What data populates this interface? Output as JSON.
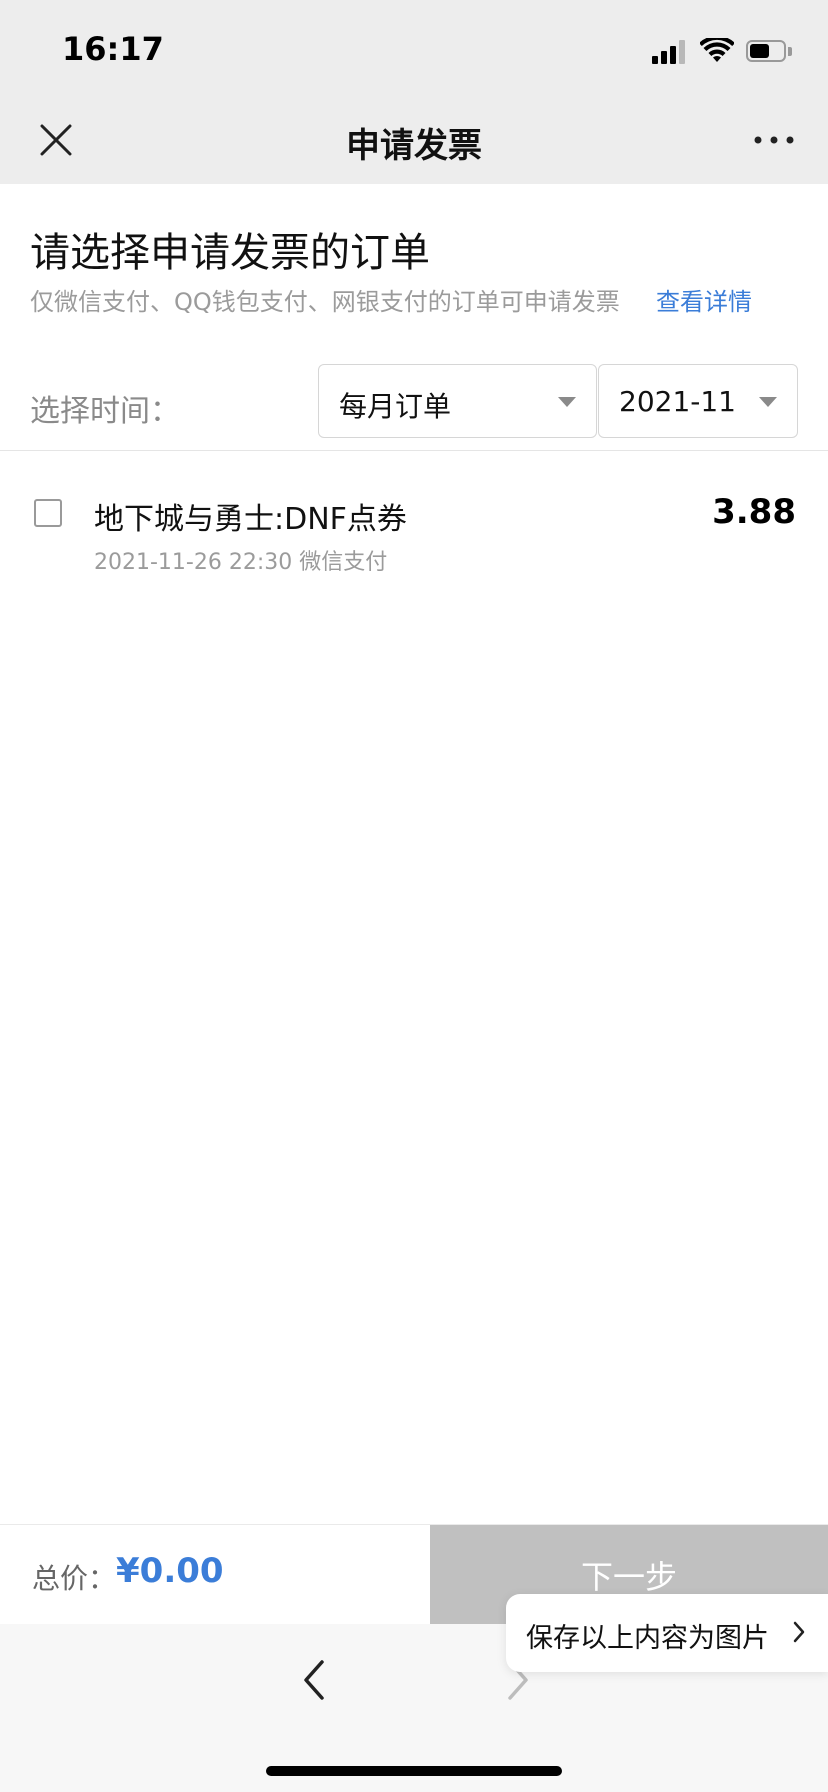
{
  "status_bar": {
    "time": "16:17",
    "icons": [
      "cellular-signal-icon",
      "wifi-icon",
      "battery-icon"
    ],
    "battery_level": 0.6
  },
  "nav": {
    "title": "申请发票",
    "close_icon": "close-icon",
    "more_icon": "more-icon"
  },
  "header": {
    "title": "请选择申请发票的订单",
    "note": "仅微信支付、QQ钱包支付、网银支付的订单可申请发票",
    "detail_link": "查看详情"
  },
  "filter": {
    "label": "选择时间：",
    "period_select": {
      "value": "每月订单"
    },
    "month_select": {
      "value": "2021-11"
    }
  },
  "orders": [
    {
      "name": "地下城与勇士:DNF点券",
      "datetime": "2021-11-26 22:30",
      "payment": "微信支付",
      "amount": "3.88",
      "checked": false
    }
  ],
  "footer": {
    "total_label": "总价：",
    "total_value": "¥0.00",
    "next_button": "下一步"
  },
  "toolbar": {
    "back_icon": "chevron-left-icon",
    "forward_icon": "chevron-right-icon"
  },
  "save_tip": {
    "label": "保存以上内容为图片",
    "chevron_icon": "chevron-right-icon"
  },
  "colors": {
    "accent_blue": "#3b7dd8",
    "bar_gray": "#ededed",
    "button_disabled": "#c0c0c0",
    "muted_text": "#9b9b9b"
  }
}
